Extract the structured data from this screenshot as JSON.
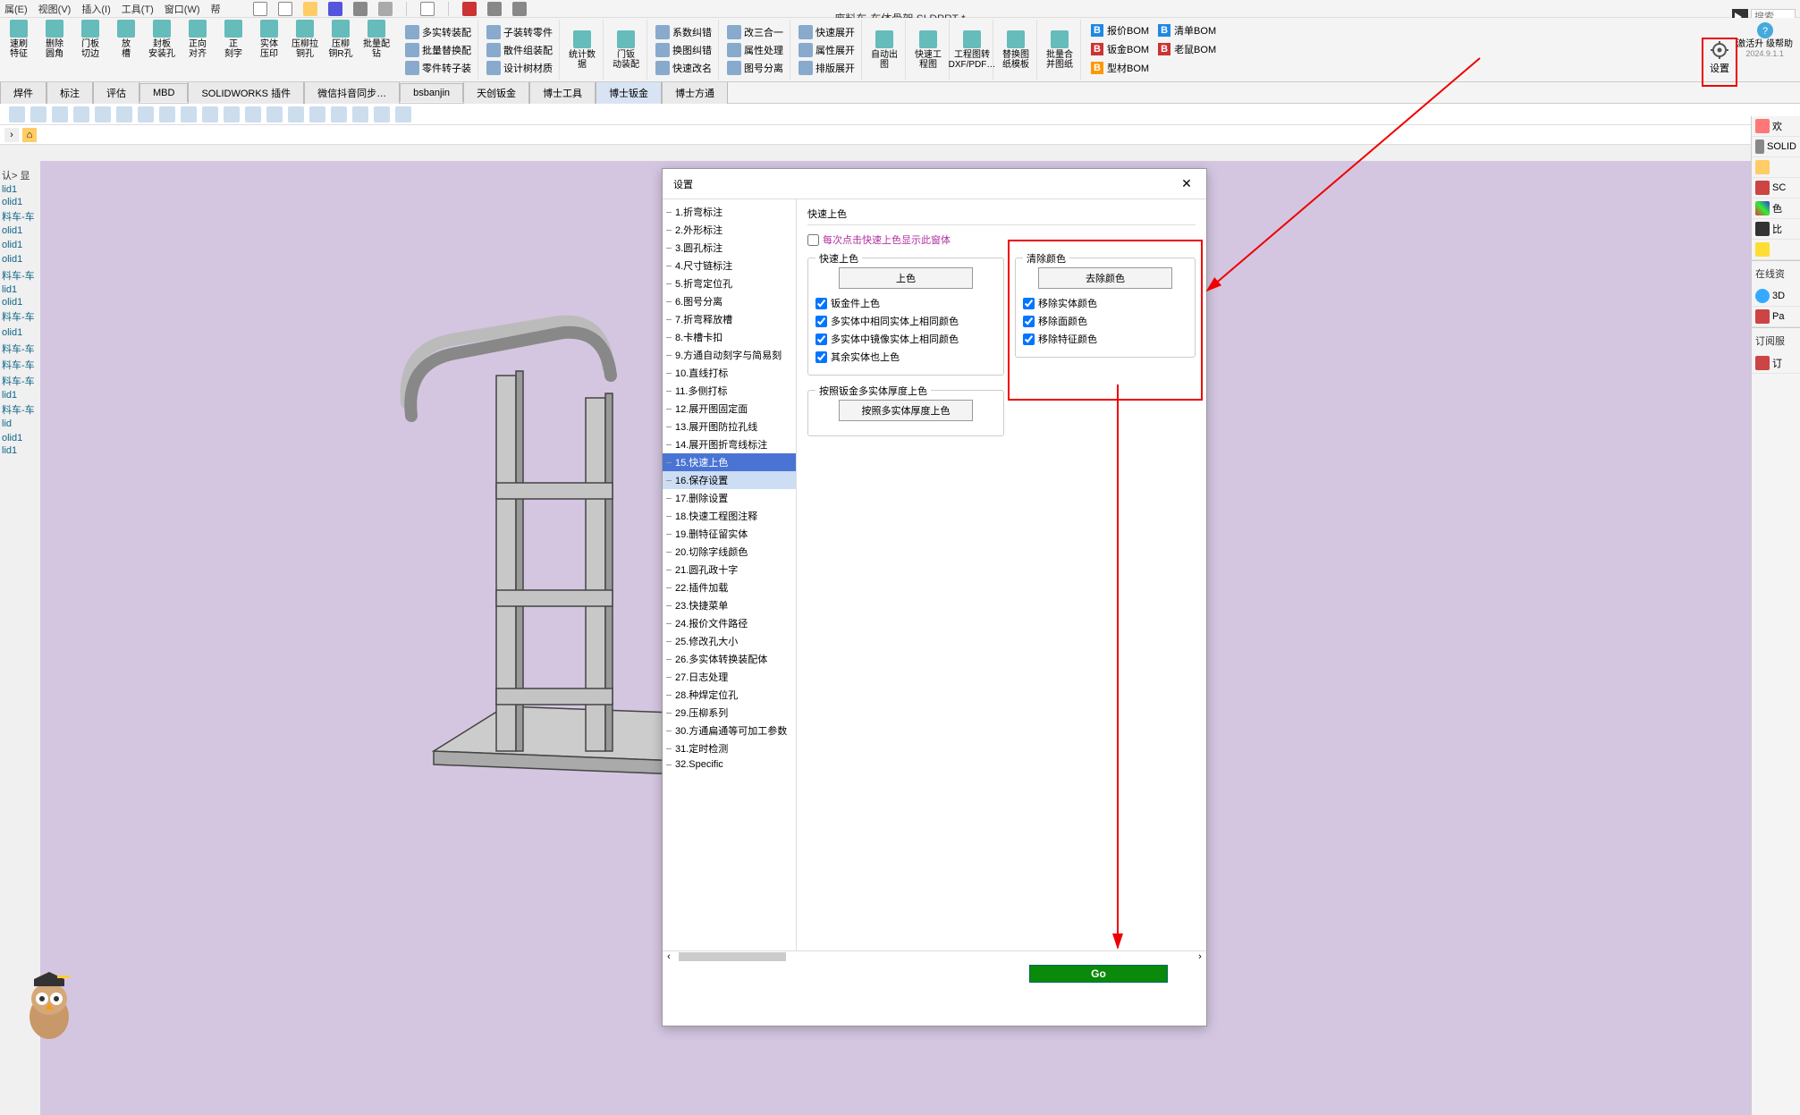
{
  "menubar": {
    "items": [
      "属(E)",
      "视图(V)",
      "插入(I)",
      "工具(T)",
      "窗口(W)",
      "帮"
    ]
  },
  "title": "废料车-车体骨架.SLDPRT *",
  "search_placeholder": "搜索",
  "ribbon": {
    "big_buttons": [
      {
        "label": "速刷\n特征"
      },
      {
        "label": "删除\n圆角"
      },
      {
        "label": "门板\n切边"
      },
      {
        "label": "放\n槽"
      },
      {
        "label": "封板\n安装孔"
      },
      {
        "label": "正向\n对齐"
      },
      {
        "label": "正\n刻字"
      },
      {
        "label": "实体\n压印"
      },
      {
        "label": "压柳拉\n铜孔"
      },
      {
        "label": "压柳\n铜R孔"
      },
      {
        "label": "批量配\n钻"
      }
    ],
    "mid_groups": [
      {
        "rows": [
          [
            "多实转装配"
          ],
          [
            "批量替换配"
          ],
          [
            "零件转子装"
          ]
        ]
      },
      {
        "rows": [
          [
            "子装转零件"
          ],
          [
            "散件组装配"
          ],
          [
            "设计树材质"
          ]
        ]
      },
      {
        "big": [
          "统计数\n据"
        ]
      },
      {
        "big": [
          "门钣\n动装配"
        ]
      },
      {
        "rows": [
          [
            "系数纠错"
          ],
          [
            "换图纠错"
          ],
          [
            "快速改名"
          ]
        ]
      },
      {
        "rows": [
          [
            "改三合一"
          ],
          [
            "属性处理"
          ],
          [
            "图号分离"
          ]
        ]
      },
      {
        "rows": [
          [
            "快速展开"
          ],
          [
            "属性展开"
          ],
          [
            "排版展开"
          ]
        ]
      },
      {
        "big": [
          "自动出\n图"
        ]
      },
      {
        "big": [
          "快速工\n程图"
        ]
      },
      {
        "big": [
          "工程图转\nDXF/PDF…"
        ]
      },
      {
        "big": [
          "替换图\n纸模板"
        ]
      },
      {
        "big": [
          "批量合\n并图纸"
        ]
      }
    ],
    "bom": [
      {
        "label": "报价BOM",
        "color": "#1e88e5"
      },
      {
        "label": "钣金BOM",
        "color": "#cc3333"
      },
      {
        "label": "型材BOM",
        "color": "#ff9800"
      },
      {
        "label": "清单BOM",
        "color": "#1e88e5"
      },
      {
        "label": "老鼠BOM",
        "color": "#cc3333"
      }
    ],
    "settings_label": "设置",
    "help_label": "激活升\n级帮助",
    "version": "2024.9.1.1"
  },
  "tabs": [
    "焊件",
    "标注",
    "评估",
    "MBD",
    "SOLIDWORKS 插件",
    "微信抖音同步…",
    "bsbanjin",
    "天创钣金",
    "博士工具",
    "博士钣金",
    "博士方通"
  ],
  "breadcrumb_hint": "认> 显",
  "feature_tree": [
    "lid1",
    "olid1",
    "料车-车",
    "olid1",
    "",
    "olid1",
    "",
    "olid1",
    "",
    "料车-车",
    "lid1",
    "olid1",
    "料车-车",
    "",
    "olid1",
    "",
    "料车-车",
    "料车-车",
    "料车-车",
    "lid1",
    "料车-车",
    "lid",
    "",
    "olid1",
    "lid1"
  ],
  "dialog": {
    "title": "设置",
    "tree": [
      "1.折弯标注",
      "2.外形标注",
      "3.圆孔标注",
      "4.尺寸链标注",
      "5.折弯定位孔",
      "6.图号分离",
      "7.折弯释放槽",
      "8.卡槽卡扣",
      "9.方通自动刻字与简易刻",
      "10.直线打标",
      "11.多侧打标",
      "12.展开图固定面",
      "13.展开图防拉孔线",
      "14.展开图折弯线标注",
      "15.快速上色",
      "16.保存设置",
      "17.删除设置",
      "18.快速工程图注释",
      "19.删特征留实体",
      "20.切除字线颜色",
      "21.圆孔政十字",
      "22.插件加载",
      "23.快捷菜单",
      "24.报价文件路径",
      "25.修改孔大小",
      "26.多实体转换装配体",
      "27.日志处理",
      "28.种焊定位孔",
      "29.压柳系列",
      "30.方通扁通等可加工参数",
      "31.定时检测",
      "32.Specific"
    ],
    "tree_selected": 14,
    "tree_selected2": 15,
    "panel_tab": "快速上色",
    "note": "每次点击快速上色显示此窗体",
    "fs1": {
      "legend": "快速上色",
      "btn": "上色",
      "checks": [
        "钣金件上色",
        "多实体中相同实体上相同颜色",
        "多实体中镜像实体上相同颜色",
        "其余实体也上色"
      ]
    },
    "fs2": {
      "legend": "清除颜色",
      "btn": "去除颜色",
      "checks": [
        "移除实体颜色",
        "移除面颜色",
        "移除特征颜色"
      ]
    },
    "fs3": {
      "legend": "按照钣金多实体厚度上色",
      "btn": "按照多实体厚度上色"
    },
    "go": "Go"
  },
  "right_side": {
    "items": [
      "欢",
      "SOLID",
      "SC",
      "色",
      "比"
    ],
    "online_title": "在线资",
    "online": [
      "3D",
      "Pa"
    ],
    "sub_title": "订阅服",
    "sub": [
      "订"
    ]
  }
}
